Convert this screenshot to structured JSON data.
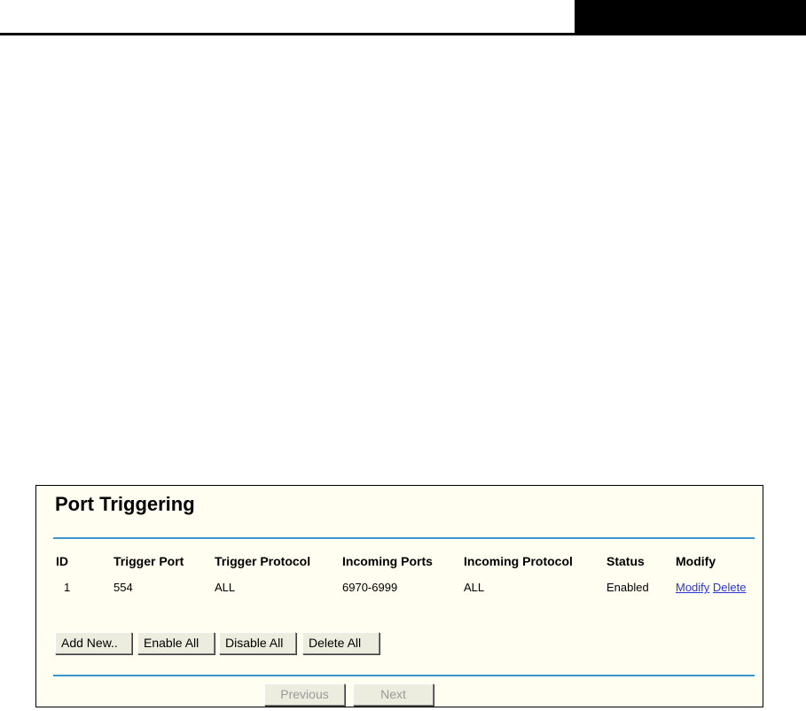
{
  "page": {
    "title": "Port Triggering"
  },
  "table": {
    "headers": {
      "id": "ID",
      "trigger_port": "Trigger Port",
      "trigger_protocol": "Trigger Protocol",
      "incoming_ports": "Incoming Ports",
      "incoming_protocol": "Incoming Protocol",
      "status": "Status",
      "modify": "Modify"
    },
    "rows": [
      {
        "id": "1",
        "trigger_port": "554",
        "trigger_protocol": "ALL",
        "incoming_ports": "6970-6999",
        "incoming_protocol": "ALL",
        "status": "Enabled",
        "modify_label": "Modify",
        "delete_label": "Delete"
      }
    ]
  },
  "actions": {
    "add_new": "Add New..",
    "enable_all": "Enable All",
    "disable_all": "Disable All",
    "delete_all": "Delete All"
  },
  "pagination": {
    "previous": "Previous",
    "next": "Next"
  },
  "colors": {
    "panel_background": "#fffef0",
    "rule": "#3c94cc",
    "link": "#2a35d6"
  }
}
